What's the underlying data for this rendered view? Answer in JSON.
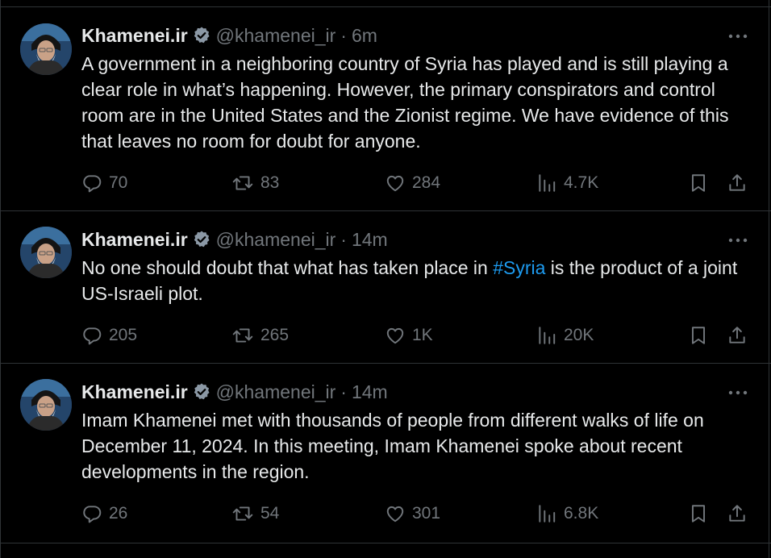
{
  "tweets": [
    {
      "name": "Khamenei.ir",
      "handle": "@khamenei_ir",
      "separator": "·",
      "time": "6m",
      "text_before": "A government in a neighboring country of Syria has played and is still playing a clear role in what’s happening. However, the primary conspirators and control room are in the United States and the Zionist regime. We have evidence of this that leaves no room for doubt for anyone.",
      "hashtag": "",
      "text_after": "",
      "replies": "70",
      "reposts": "83",
      "likes": "284",
      "views": "4.7K"
    },
    {
      "name": "Khamenei.ir",
      "handle": "@khamenei_ir",
      "separator": "·",
      "time": "14m",
      "text_before": "No one should doubt that what has taken place in ",
      "hashtag": "#Syria",
      "text_after": " is the product of a joint US-Israeli plot.",
      "replies": "205",
      "reposts": "265",
      "likes": "1K",
      "views": "20K"
    },
    {
      "name": "Khamenei.ir",
      "handle": "@khamenei_ir",
      "separator": "·",
      "time": "14m",
      "text_before": "Imam Khamenei met with thousands of people from different walks of life on December 11, 2024. In this meeting, Imam Khamenei spoke about recent developments in the region.",
      "hashtag": "",
      "text_after": "",
      "replies": "26",
      "reposts": "54",
      "likes": "301",
      "views": "6.8K"
    }
  ],
  "icons": {
    "verified": "verified-badge-icon",
    "more": "more-dots-icon",
    "reply": "reply-bubble-icon",
    "repost": "repost-arrows-icon",
    "like": "heart-icon",
    "views": "views-bars-icon",
    "bookmark": "bookmark-icon",
    "share": "share-upload-icon"
  },
  "colors": {
    "background": "#000000",
    "text": "#e7e9ea",
    "muted": "#71767b",
    "accent": "#1d9bf0",
    "divider": "#2f3336"
  }
}
